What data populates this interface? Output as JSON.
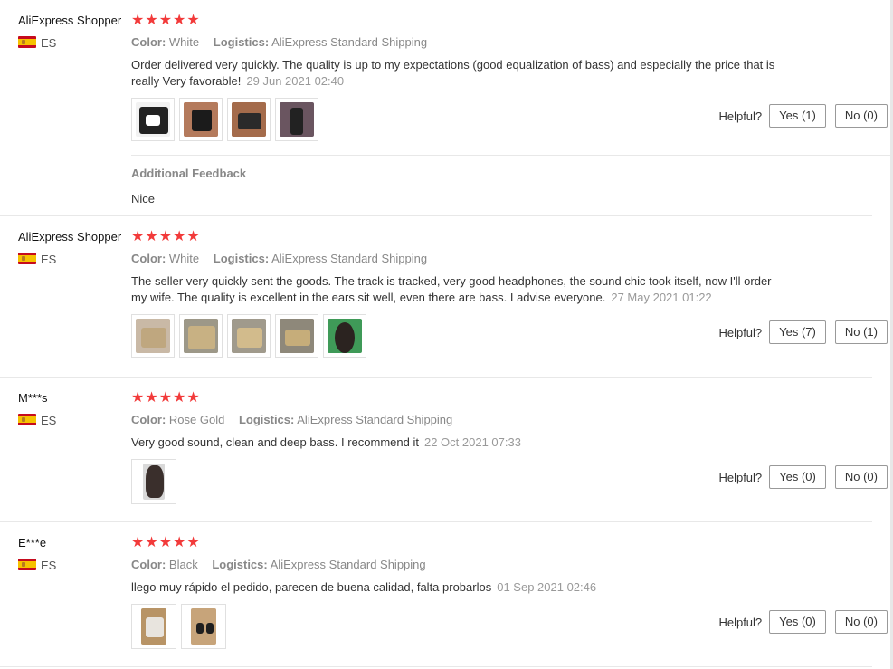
{
  "helpful_label": "Helpful?",
  "reviews": [
    {
      "name": "AliExpress Shopper",
      "country": "ES",
      "stars": "★★★★★",
      "color_label": "Color:",
      "color": "White",
      "logistics_label": "Logistics:",
      "logistics": "AliExpress Standard Shipping",
      "text": "Order delivered very quickly. The quality is up to my expectations (good equalization of bass) and especially the price that is really Very favorable!",
      "date": "29 Jun 2021 02:40",
      "yes": "Yes (1)",
      "no": "No (0)",
      "additional_title": "Additional Feedback",
      "additional_text": "Nice"
    },
    {
      "name": "AliExpress Shopper",
      "country": "ES",
      "stars": "★★★★★",
      "color_label": "Color:",
      "color": "White",
      "logistics_label": "Logistics:",
      "logistics": "AliExpress Standard Shipping",
      "text": "The seller very quickly sent the goods. The track is tracked, very good headphones, the sound chic took itself, now I'll order my wife. The quality is excellent in the ears sit well, even there are bass. I advise everyone.",
      "date": "27 May 2021 01:22",
      "yes": "Yes (7)",
      "no": "No (1)"
    },
    {
      "name": "M***s",
      "country": "ES",
      "stars": "★★★★★",
      "color_label": "Color:",
      "color": "Rose Gold",
      "logistics_label": "Logistics:",
      "logistics": "AliExpress Standard Shipping",
      "text": "Very good sound, clean and deep bass. I recommend it",
      "date": "22 Oct 2021 07:33",
      "yes": "Yes (0)",
      "no": "No (0)"
    },
    {
      "name": "E***e",
      "country": "ES",
      "stars": "★★★★★",
      "color_label": "Color:",
      "color": "Black",
      "logistics_label": "Logistics:",
      "logistics": "AliExpress Standard Shipping",
      "text": "llego muy rápido el pedido, parecen de buena calidad, falta probarlos",
      "date": "01 Sep 2021 02:46",
      "yes": "Yes (0)",
      "no": "No (0)"
    }
  ],
  "colors": {
    "star": "#f23a3a",
    "flag_red": "#c60b1e",
    "flag_yellow": "#f6c200"
  }
}
